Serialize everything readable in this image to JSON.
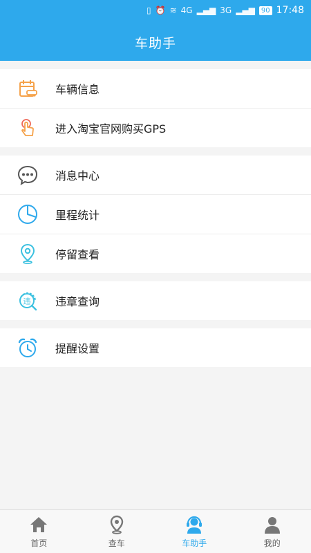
{
  "status": {
    "signal_4g": "4G",
    "signal_3g": "3G",
    "battery": "90",
    "time": "17:48"
  },
  "header": {
    "title": "车助手"
  },
  "groups": [
    [
      {
        "label": "车辆信息",
        "icon": "calendar-car-icon"
      },
      {
        "label": "进入淘宝官网购买GPS",
        "icon": "tap-hand-icon"
      }
    ],
    [
      {
        "label": "消息中心",
        "icon": "chat-bubble-icon"
      },
      {
        "label": "里程统计",
        "icon": "pie-chart-icon"
      },
      {
        "label": "停留查看",
        "icon": "location-pin-icon"
      }
    ],
    [
      {
        "label": "违章查询",
        "icon": "violation-search-icon",
        "glyph": "违"
      }
    ],
    [
      {
        "label": "提醒设置",
        "icon": "alarm-clock-icon"
      }
    ]
  ],
  "tabs": [
    {
      "label": "首页",
      "icon": "home-icon"
    },
    {
      "label": "查车",
      "icon": "map-pin-icon"
    },
    {
      "label": "车助手",
      "icon": "headset-assistant-icon",
      "active": true
    },
    {
      "label": "我的",
      "icon": "user-icon"
    }
  ],
  "colors": {
    "accent": "#2ea9ec",
    "orange": "#f5a24a",
    "red": "#ee6a5a",
    "dark": "#555555"
  }
}
